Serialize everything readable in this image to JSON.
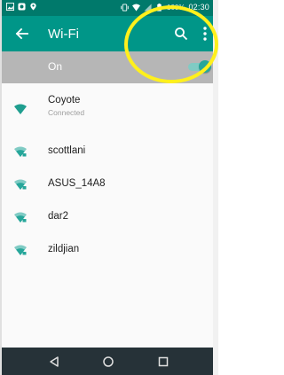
{
  "status_bar": {
    "battery_text": "100%",
    "time": "02:30"
  },
  "app_bar": {
    "title": "Wi-Fi",
    "back_icon": "arrow-left-icon",
    "search_icon": "search-icon",
    "more_icon": "more-vert-icon"
  },
  "toggle": {
    "label": "On",
    "state": "on",
    "accent_color": "#26a69a"
  },
  "networks": [
    {
      "name": "Coyote",
      "status": "Connected"
    },
    {
      "name": "scottlani"
    },
    {
      "name": "ASUS_14A8"
    },
    {
      "name": "dar2"
    },
    {
      "name": "zildjian"
    }
  ],
  "nav_bar": {
    "back_icon": "triangle-back-icon",
    "home_icon": "circle-home-icon",
    "recents_icon": "square-recents-icon"
  },
  "colors": {
    "status_bar": "#00796b",
    "app_bar": "#009688",
    "toggle_bar": "#b6b6b6",
    "wifi_icon": "#26a69a",
    "nav_bar": "#263238",
    "highlight": "#fff01c"
  }
}
